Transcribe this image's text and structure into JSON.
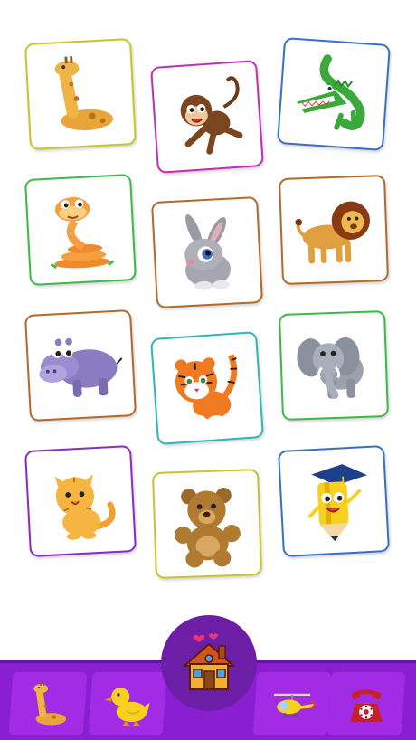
{
  "colors": {
    "background": "#ffffff",
    "bottom_bar": "#8a1fd1",
    "nav_tile": "#a22be6",
    "home_circle": "#6c1fa6"
  },
  "cards": [
    {
      "icon": "giraffe-icon",
      "border": "#c9c42a"
    },
    {
      "icon": "monkey-icon",
      "border": "#c22fb0"
    },
    {
      "icon": "crocodile-icon",
      "border": "#3a6fc9"
    },
    {
      "icon": "snake-icon",
      "border": "#3db84a"
    },
    {
      "icon": "rabbit-icon",
      "border": "#b36a2b"
    },
    {
      "icon": "lion-icon",
      "border": "#b36a2b"
    },
    {
      "icon": "hippo-icon",
      "border": "#b36a2b"
    },
    {
      "icon": "tiger-icon",
      "border": "#2bb8b8"
    },
    {
      "icon": "elephant-icon",
      "border": "#3db84a"
    },
    {
      "icon": "cat-icon",
      "border": "#8a2bc9"
    },
    {
      "icon": "teddy-bear-icon",
      "border": "#c9c42a"
    },
    {
      "icon": "pencil-icon",
      "border": "#3a6fc9"
    }
  ],
  "bottom_nav": {
    "items": [
      {
        "icon": "giraffe-icon"
      },
      {
        "icon": "duck-icon"
      },
      {
        "icon": "helicopter-icon"
      },
      {
        "icon": "telephone-icon"
      }
    ],
    "home": {
      "icon": "house-icon"
    }
  }
}
